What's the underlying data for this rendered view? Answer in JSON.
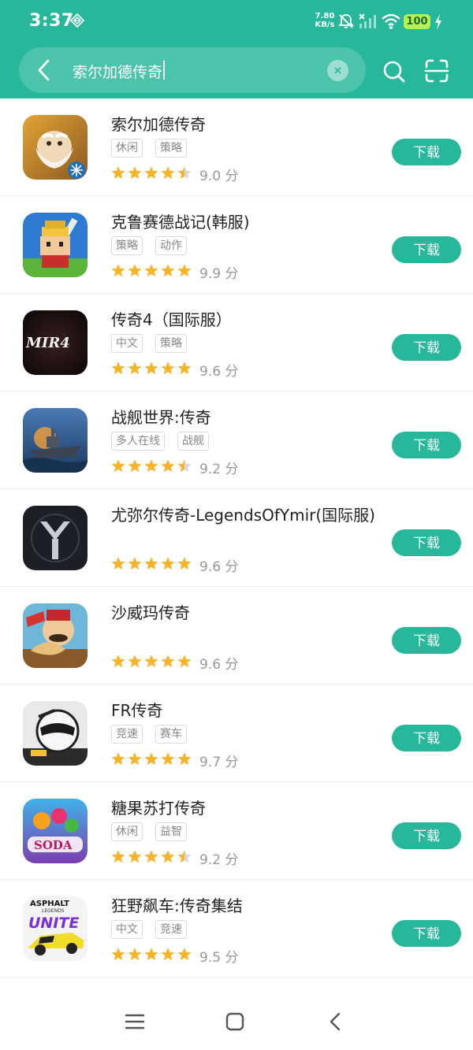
{
  "status_bar": {
    "time": "3:37",
    "net_speed_value": "7.80",
    "net_speed_unit": "KB/s",
    "battery": "100",
    "icons": [
      "diamond-icon",
      "mute-icon",
      "signal-icon",
      "wifi-icon",
      "charging-icon"
    ]
  },
  "search": {
    "query": "索尔加德传奇",
    "icons": [
      "back-icon",
      "clear-icon",
      "search-icon",
      "scan-icon"
    ]
  },
  "colors": {
    "brand": "#27b89b",
    "star": "#f7b52c",
    "star_empty": "#d8d8d8",
    "tag_border": "#dcdcdc",
    "score_text": "#999999"
  },
  "apps": [
    {
      "name": "索尔加德传奇",
      "tags": [
        "休闲",
        "策略"
      ],
      "rating_stars": 4.5,
      "score": "9.0 分",
      "button": "下载",
      "icon": "saltgard-icon"
    },
    {
      "name": "克鲁赛德战记(韩服)",
      "tags": [
        "策略",
        "动作"
      ],
      "rating_stars": 5,
      "score": "9.9 分",
      "button": "下载",
      "icon": "crusaders-icon"
    },
    {
      "name": "传奇4（国际服）",
      "tags": [
        "中文",
        "策略"
      ],
      "rating_stars": 5,
      "score": "9.6 分",
      "button": "下载",
      "icon": "mir4-icon"
    },
    {
      "name": "战舰世界:传奇",
      "tags": [
        "多人在线",
        "战舰"
      ],
      "rating_stars": 4.5,
      "score": "9.2 分",
      "button": "下载",
      "icon": "warships-icon"
    },
    {
      "name": "尤弥尔传奇-LegendsOfYmir(国际服)",
      "tags": [],
      "rating_stars": 5,
      "score": "9.6 分",
      "button": "下载",
      "icon": "ymir-icon"
    },
    {
      "name": "沙威玛传奇",
      "tags": [],
      "rating_stars": 5,
      "score": "9.6 分",
      "button": "下载",
      "icon": "shawarma-icon"
    },
    {
      "name": "FR传奇",
      "tags": [
        "竞速",
        "赛车"
      ],
      "rating_stars": 5,
      "score": "9.7 分",
      "button": "下载",
      "icon": "fr-legends-icon"
    },
    {
      "name": "糖果苏打传奇",
      "tags": [
        "休闲",
        "益智"
      ],
      "rating_stars": 4.5,
      "score": "9.2 分",
      "button": "下载",
      "icon": "candy-soda-icon"
    },
    {
      "name": "狂野飙车:传奇集结",
      "tags": [
        "中文",
        "竞速"
      ],
      "rating_stars": 5,
      "score": "9.5 分",
      "button": "下载",
      "icon": "asphalt-unite-icon"
    }
  ],
  "icon_texts": {
    "mir4": "MIR4",
    "candy_soda": "SODA",
    "asphalt_top": "ASPHALT",
    "asphalt_legends": "LEGENDS",
    "asphalt_unite": "UNITE"
  },
  "nav": [
    "menu-icon",
    "home-icon",
    "back-nav-icon"
  ]
}
